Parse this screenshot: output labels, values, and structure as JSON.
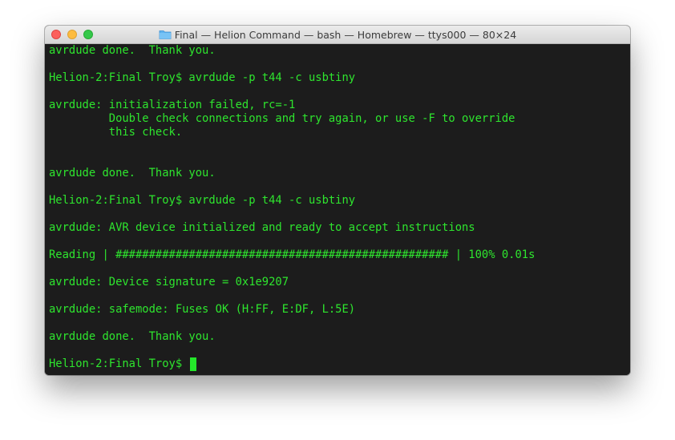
{
  "window": {
    "title": "Final — Helion Command — bash — Homebrew — ttys000 — 80×24"
  },
  "terminal": {
    "lines": [
      "avrdude done.  Thank you.",
      "",
      "Helion-2:Final Troy$ avrdude -p t44 -c usbtiny",
      "",
      "avrdude: initialization failed, rc=-1",
      "         Double check connections and try again, or use -F to override",
      "         this check.",
      "",
      "",
      "avrdude done.  Thank you.",
      "",
      "Helion-2:Final Troy$ avrdude -p t44 -c usbtiny",
      "",
      "avrdude: AVR device initialized and ready to accept instructions",
      "",
      "Reading | ################################################## | 100% 0.01s",
      "",
      "avrdude: Device signature = 0x1e9207",
      "",
      "avrdude: safemode: Fuses OK (H:FF, E:DF, L:5E)",
      "",
      "avrdude done.  Thank you.",
      "",
      "Helion-2:Final Troy$ "
    ]
  },
  "colors": {
    "text": "#2ee52e",
    "background": "#1c1c1c",
    "cursor": "#24e62a"
  },
  "icons": {
    "title_icon": "folder-icon"
  }
}
